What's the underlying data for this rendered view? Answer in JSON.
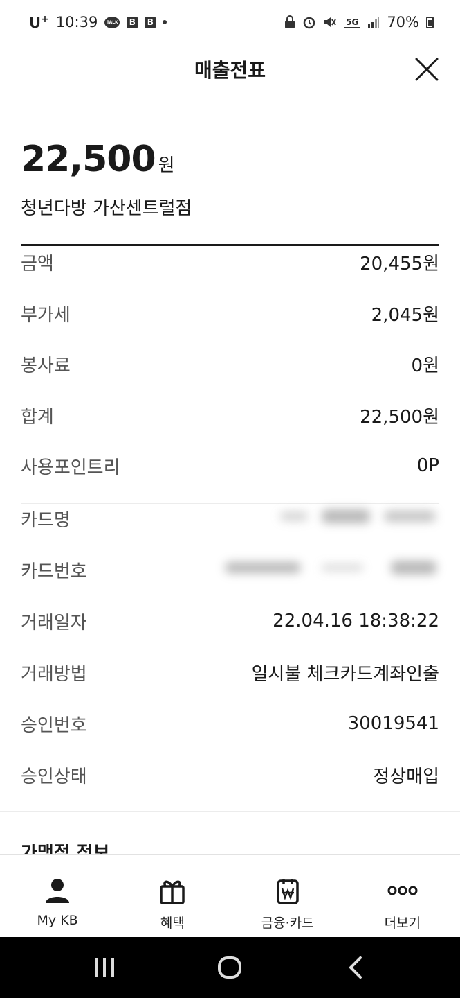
{
  "status_bar": {
    "carrier": "U",
    "carrier_sup": "+",
    "time": "10:39",
    "talk_label": "TALK",
    "b_label": "B",
    "network": "5G",
    "battery": "70%"
  },
  "header": {
    "title": "매출전표"
  },
  "receipt": {
    "amount": "22,500",
    "amount_unit": "원",
    "merchant": "청년다방 가산센트럴점"
  },
  "rows": [
    {
      "label": "금액",
      "value": "20,455원"
    },
    {
      "label": "부가세",
      "value": "2,045원"
    },
    {
      "label": "봉사료",
      "value": "0원"
    },
    {
      "label": "합계",
      "value": "22,500원"
    },
    {
      "label": "사용포인트리",
      "value": "0P"
    }
  ],
  "details": [
    {
      "label": "카드명",
      "value": ""
    },
    {
      "label": "카드번호",
      "value": ""
    },
    {
      "label": "거래일자",
      "value": "22.04.16 18:38:22"
    },
    {
      "label": "거래방법",
      "value": "일시불 체크카드계좌인출"
    },
    {
      "label": "승인번호",
      "value": "30019541"
    },
    {
      "label": "승인상태",
      "value": "정상매입"
    }
  ],
  "partial_section": "가맹점 정보",
  "bottom_nav": [
    {
      "label": "My KB",
      "icon": "person-icon"
    },
    {
      "label": "혜택",
      "icon": "gift-icon"
    },
    {
      "label": "금융·카드",
      "icon": "won-bag-icon"
    },
    {
      "label": "더보기",
      "icon": "more-icon"
    }
  ],
  "colors": {
    "text": "#1a1a1a",
    "label": "#555555",
    "rule": "#1a1a1a",
    "system_nav": "#000000"
  }
}
